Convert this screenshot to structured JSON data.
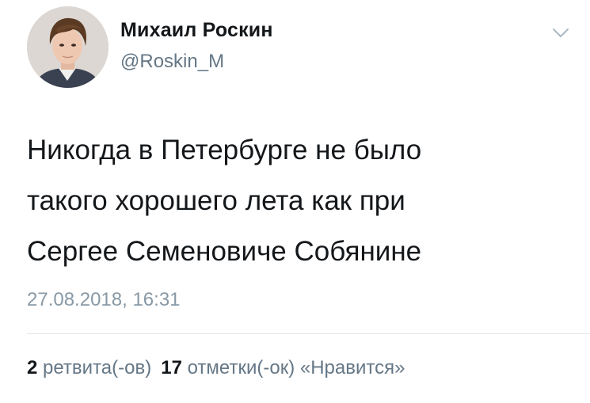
{
  "author": {
    "display_name": "Михаил Роскин",
    "handle": "@Roskin_M"
  },
  "tweet": {
    "lines": [
      "Никогда в Петербурге не было",
      "такого хорошего лета как при",
      "Сергее Семеновиче Собянине"
    ],
    "timestamp": "27.08.2018, 16:31"
  },
  "stats": {
    "retweets_count": "2",
    "retweets_label": "ретвита(-ов)",
    "likes_count": "17",
    "likes_label": "отметки(-ок) «Нравится»"
  },
  "icons": {
    "menu": "chevron-down-icon",
    "avatar": "avatar"
  },
  "colors": {
    "text_primary": "#14171a",
    "text_secondary": "#657786",
    "timestamp": "#8899a6",
    "divider": "#e1e8ed"
  }
}
